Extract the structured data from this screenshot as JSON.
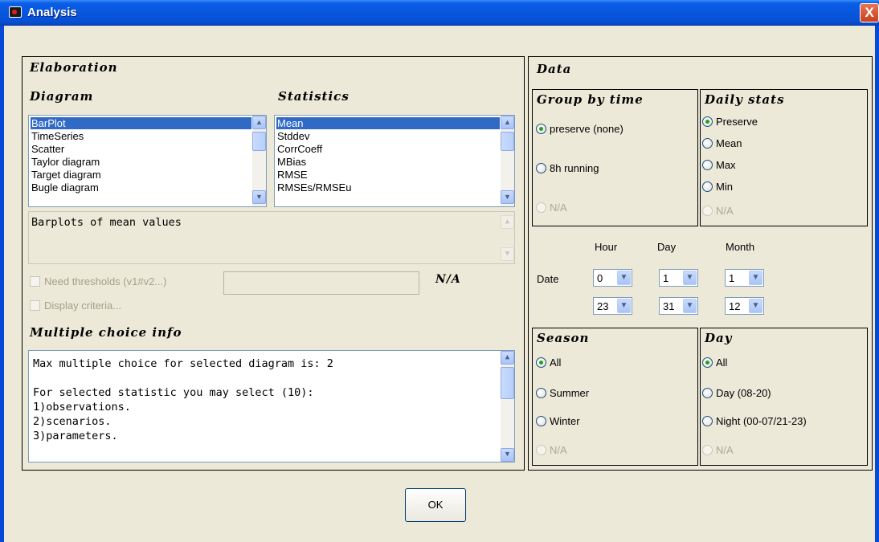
{
  "window": {
    "title": "Analysis",
    "close_label": "X"
  },
  "elaboration": {
    "title": "Elaboration",
    "diagram_header": "Diagram",
    "statistics_header": "Statistics",
    "diagram_items": [
      "BarPlot",
      "TimeSeries",
      "Scatter",
      "Taylor diagram",
      "Target diagram",
      "Bugle diagram"
    ],
    "statistics_items": [
      "Mean",
      "Stddev",
      "CorrCoeff",
      "MBias",
      "RMSE",
      "RMSEs/RMSEu"
    ],
    "description": "Barplots of mean values",
    "need_thresholds_label": "Need thresholds (v1#v2...)",
    "display_criteria_label": "Display criteria...",
    "threshold_na": "N/A",
    "multiple_choice_title": "Multiple choice info",
    "multiple_choice_text": "Max multiple choice for selected diagram is: 2\n\nFor selected statistic you may select (10):\n1)observations.\n2)scenarios.\n3)parameters."
  },
  "data": {
    "title": "Data",
    "group_by_time": {
      "title": "Group by time",
      "options": [
        "preserve (none)",
        "8h running",
        "N/A"
      ],
      "selected": 0
    },
    "daily_stats": {
      "title": "Daily stats",
      "options": [
        "Preserve",
        "Mean",
        "Max",
        "Min",
        "N/A"
      ],
      "selected": 0
    },
    "date": {
      "label": "Date",
      "hour_label": "Hour",
      "day_label": "Day",
      "month_label": "Month",
      "hour_from": "0",
      "day_from": "1",
      "month_from": "1",
      "hour_to": "23",
      "day_to": "31",
      "month_to": "12"
    },
    "season": {
      "title": "Season",
      "options": [
        "All",
        "Summer",
        "Winter",
        "N/A"
      ],
      "selected": 0
    },
    "day": {
      "title": "Day",
      "options": [
        "All",
        "Day (08-20)",
        "Night (00-07/21-23)",
        "N/A"
      ],
      "selected": 0
    }
  },
  "ok_label": "OK"
}
